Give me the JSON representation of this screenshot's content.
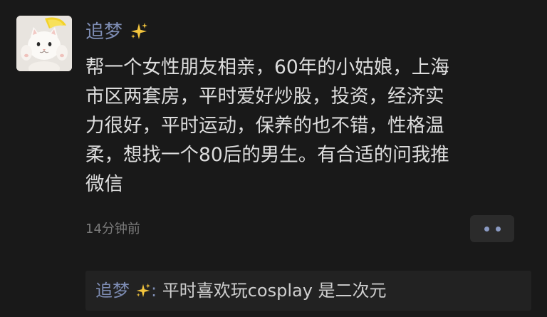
{
  "post": {
    "author": "追梦",
    "author_emoji": "sparkles",
    "content_lines": [
      "帮一个女性朋友相亲，60年的小姑娘，上海",
      "市区两套房，平时爱好炒股，投资，经济实",
      "力很好，平时运动，保养的也不错，性格温",
      "柔，想找一个80后的男生。有合适的问我推",
      "微信"
    ],
    "timestamp": "14分钟前",
    "more_button_icon": "more-dots-icon"
  },
  "comments": [
    {
      "author": "追梦",
      "separator": ":",
      "text": " 平时喜欢玩cosplay 是二次元"
    }
  ],
  "colors": {
    "background": "#191919",
    "name_blue": "#7e8db4",
    "text": "#dddddd",
    "muted": "#7a7a7a",
    "comment_bg": "#222222",
    "sparkle": "#f2c43d"
  }
}
